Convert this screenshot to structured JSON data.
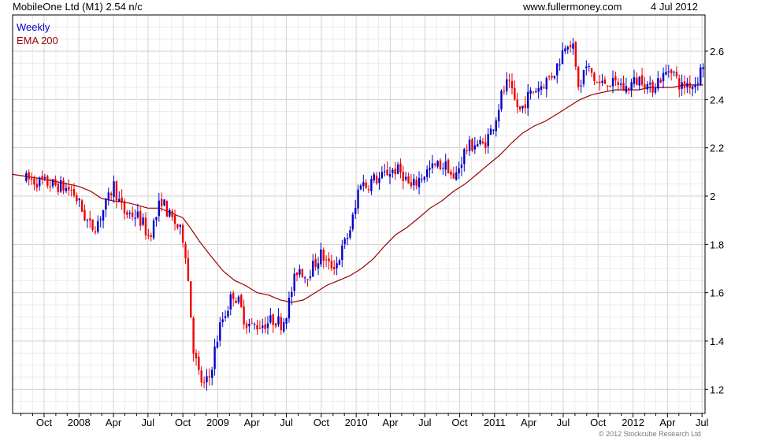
{
  "header": {
    "title": "MobileOne Ltd (M1) 2.54 n/c",
    "site": "www.fullermoney.com",
    "date": "4 Jul 2012"
  },
  "legend": {
    "weekly_label": "Weekly",
    "ema_label": "EMA 200"
  },
  "colors": {
    "up": "#0000cc",
    "down": "#ee0000",
    "ema": "#990000",
    "grid": "#d8d8d8",
    "frame": "#000000"
  },
  "footer": {
    "credit": "© 2012 Stockcube Research Ltd"
  },
  "chart_data": {
    "type": "candlestick",
    "frequency": "weekly",
    "ylim": [
      1.1,
      2.75
    ],
    "y_ticks": [
      1.2,
      1.4,
      1.6,
      1.8,
      2,
      2.2,
      2.4,
      2.6
    ],
    "x_ticks": [
      "Oct",
      "2008",
      "Apr",
      "Jul",
      "Oct",
      "2009",
      "Apr",
      "Jul",
      "Oct",
      "2010",
      "Apr",
      "Jul",
      "Oct",
      "2011",
      "Apr",
      "Jul",
      "Oct",
      "2012",
      "Apr",
      "Jul"
    ],
    "price_path": [
      [
        "2007-08-15",
        2.07
      ],
      [
        "2007-09-15",
        2.06
      ],
      [
        "2007-10-15",
        2.05
      ],
      [
        "2007-11-15",
        2.04
      ],
      [
        "2007-12-15",
        2.02
      ],
      [
        "2008-01-01",
        1.97
      ],
      [
        "2008-01-15",
        1.92
      ],
      [
        "2008-02-01",
        1.87
      ],
      [
        "2008-02-15",
        1.88
      ],
      [
        "2008-03-01",
        1.93
      ],
      [
        "2008-03-20",
        1.99
      ],
      [
        "2008-04-01",
        2.05
      ],
      [
        "2008-04-15",
        1.98
      ],
      [
        "2008-05-01",
        1.93
      ],
      [
        "2008-06-01",
        1.92
      ],
      [
        "2008-06-20",
        1.88
      ],
      [
        "2008-07-01",
        1.83
      ],
      [
        "2008-07-20",
        1.9
      ],
      [
        "2008-08-05",
        1.99
      ],
      [
        "2008-08-25",
        1.92
      ],
      [
        "2008-09-15",
        1.88
      ],
      [
        "2008-10-01",
        1.83
      ],
      [
        "2008-10-10",
        1.75
      ],
      [
        "2008-10-20",
        1.55
      ],
      [
        "2008-10-28",
        1.38
      ],
      [
        "2008-11-10",
        1.27
      ],
      [
        "2008-11-25",
        1.21
      ],
      [
        "2008-12-10",
        1.25
      ],
      [
        "2008-12-25",
        1.37
      ],
      [
        "2009-01-10",
        1.48
      ],
      [
        "2009-01-25",
        1.53
      ],
      [
        "2009-02-10",
        1.6
      ],
      [
        "2009-02-25",
        1.56
      ],
      [
        "2009-03-15",
        1.48
      ],
      [
        "2009-04-01",
        1.46
      ],
      [
        "2009-05-01",
        1.47
      ],
      [
        "2009-06-01",
        1.49
      ],
      [
        "2009-06-20",
        1.47
      ],
      [
        "2009-07-05",
        1.54
      ],
      [
        "2009-07-15",
        1.61
      ],
      [
        "2009-08-01",
        1.71
      ],
      [
        "2009-08-20",
        1.67
      ],
      [
        "2009-09-10",
        1.71
      ],
      [
        "2009-10-01",
        1.76
      ],
      [
        "2009-10-20",
        1.71
      ],
      [
        "2009-11-10",
        1.72
      ],
      [
        "2009-12-01",
        1.8
      ],
      [
        "2009-12-15",
        1.86
      ],
      [
        "2010-01-01",
        1.96
      ],
      [
        "2010-01-10",
        2.07
      ],
      [
        "2010-01-25",
        2.04
      ],
      [
        "2010-02-15",
        2.07
      ],
      [
        "2010-03-05",
        2.07
      ],
      [
        "2010-03-25",
        2.1
      ],
      [
        "2010-04-15",
        2.11
      ],
      [
        "2010-05-05",
        2.09
      ],
      [
        "2010-05-25",
        2.03
      ],
      [
        "2010-06-15",
        2.07
      ],
      [
        "2010-07-05",
        2.1
      ],
      [
        "2010-07-25",
        2.12
      ],
      [
        "2010-08-15",
        2.13
      ],
      [
        "2010-09-01",
        2.12
      ],
      [
        "2010-09-15",
        2.06
      ],
      [
        "2010-10-01",
        2.13
      ],
      [
        "2010-10-15",
        2.19
      ],
      [
        "2010-11-10",
        2.22
      ],
      [
        "2010-12-01",
        2.21
      ],
      [
        "2010-12-20",
        2.26
      ],
      [
        "2011-01-05",
        2.33
      ],
      [
        "2011-01-20",
        2.42
      ],
      [
        "2011-02-05",
        2.47
      ],
      [
        "2011-02-20",
        2.4
      ],
      [
        "2011-03-10",
        2.35
      ],
      [
        "2011-03-25",
        2.4
      ],
      [
        "2011-04-15",
        2.44
      ],
      [
        "2011-05-05",
        2.46
      ],
      [
        "2011-05-25",
        2.49
      ],
      [
        "2011-06-10",
        2.52
      ],
      [
        "2011-06-25",
        2.58
      ],
      [
        "2011-07-10",
        2.65
      ],
      [
        "2011-07-25",
        2.63
      ],
      [
        "2011-08-05",
        2.5
      ],
      [
        "2011-08-15",
        2.43
      ],
      [
        "2011-08-25",
        2.53
      ],
      [
        "2011-09-10",
        2.52
      ],
      [
        "2011-09-25",
        2.47
      ],
      [
        "2011-10-10",
        2.46
      ],
      [
        "2011-10-25",
        2.48
      ],
      [
        "2011-11-10",
        2.46
      ],
      [
        "2011-11-25",
        2.47
      ],
      [
        "2011-12-10",
        2.44
      ],
      [
        "2012-01-01",
        2.47
      ],
      [
        "2012-01-25",
        2.49
      ],
      [
        "2012-02-15",
        2.44
      ],
      [
        "2012-03-05",
        2.48
      ],
      [
        "2012-03-25",
        2.5
      ],
      [
        "2012-04-10",
        2.54
      ],
      [
        "2012-04-25",
        2.48
      ],
      [
        "2012-05-10",
        2.45
      ],
      [
        "2012-05-25",
        2.47
      ],
      [
        "2012-06-10",
        2.46
      ],
      [
        "2012-06-25",
        2.51
      ],
      [
        "2012-07-04",
        2.55
      ]
    ],
    "ema_200": [
      [
        "2007-07-10",
        2.09
      ],
      [
        "2007-10-01",
        2.07
      ],
      [
        "2008-01-01",
        2.04
      ],
      [
        "2008-02-01",
        2.02
      ],
      [
        "2008-03-01",
        1.99
      ],
      [
        "2008-04-01",
        1.98
      ],
      [
        "2008-05-15",
        1.97
      ],
      [
        "2008-07-01",
        1.95
      ],
      [
        "2008-08-01",
        1.95
      ],
      [
        "2008-09-01",
        1.93
      ],
      [
        "2008-10-01",
        1.91
      ],
      [
        "2008-10-20",
        1.87
      ],
      [
        "2008-11-15",
        1.81
      ],
      [
        "2008-12-15",
        1.75
      ],
      [
        "2009-01-15",
        1.69
      ],
      [
        "2009-02-15",
        1.65
      ],
      [
        "2009-03-15",
        1.63
      ],
      [
        "2009-04-15",
        1.6
      ],
      [
        "2009-05-15",
        1.59
      ],
      [
        "2009-06-15",
        1.57
      ],
      [
        "2009-07-15",
        1.56
      ],
      [
        "2009-08-15",
        1.57
      ],
      [
        "2009-09-15",
        1.6
      ],
      [
        "2009-10-15",
        1.63
      ],
      [
        "2009-11-15",
        1.65
      ],
      [
        "2009-12-15",
        1.67
      ],
      [
        "2010-01-15",
        1.7
      ],
      [
        "2010-02-15",
        1.74
      ],
      [
        "2010-03-15",
        1.79
      ],
      [
        "2010-04-15",
        1.84
      ],
      [
        "2010-05-15",
        1.87
      ],
      [
        "2010-06-15",
        1.91
      ],
      [
        "2010-07-15",
        1.95
      ],
      [
        "2010-08-15",
        1.98
      ],
      [
        "2010-09-15",
        2.02
      ],
      [
        "2010-10-15",
        2.05
      ],
      [
        "2010-11-15",
        2.09
      ],
      [
        "2010-12-15",
        2.13
      ],
      [
        "2011-01-15",
        2.17
      ],
      [
        "2011-02-15",
        2.22
      ],
      [
        "2011-03-15",
        2.26
      ],
      [
        "2011-04-15",
        2.29
      ],
      [
        "2011-05-15",
        2.31
      ],
      [
        "2011-06-15",
        2.34
      ],
      [
        "2011-07-15",
        2.37
      ],
      [
        "2011-08-15",
        2.4
      ],
      [
        "2011-09-15",
        2.42
      ],
      [
        "2011-10-15",
        2.43
      ],
      [
        "2011-11-15",
        2.44
      ],
      [
        "2011-12-15",
        2.44
      ],
      [
        "2012-01-15",
        2.44
      ],
      [
        "2012-02-15",
        2.45
      ],
      [
        "2012-03-15",
        2.45
      ],
      [
        "2012-04-15",
        2.45
      ],
      [
        "2012-05-15",
        2.46
      ],
      [
        "2012-06-15",
        2.46
      ],
      [
        "2012-07-04",
        2.46
      ]
    ]
  }
}
